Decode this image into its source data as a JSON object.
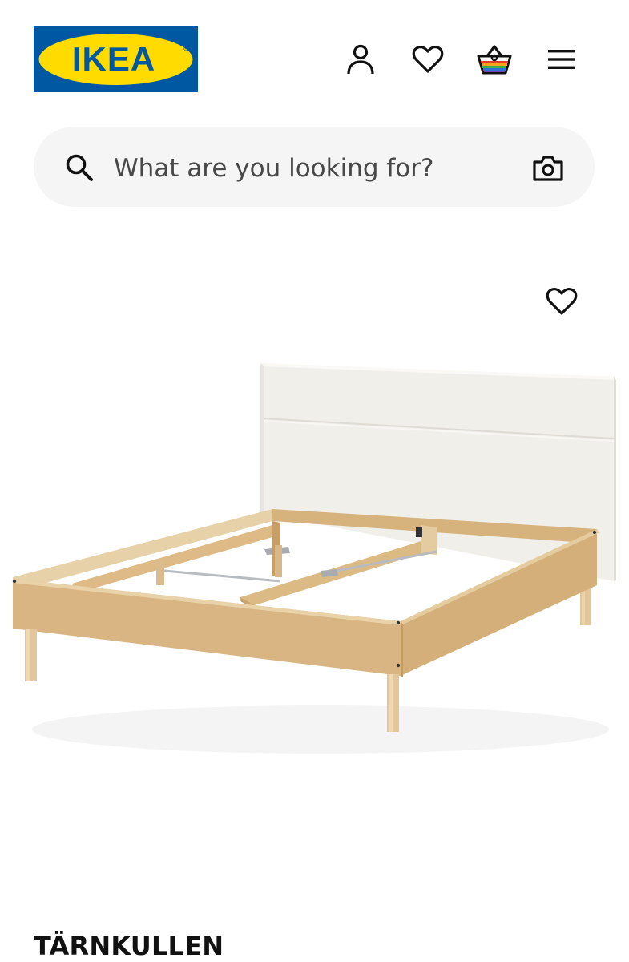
{
  "header": {
    "logo_text": "IKEA",
    "logo_registered": "®",
    "icons": {
      "account": "person-icon",
      "favorites": "heart-icon",
      "cart": "shopping-basket-icon",
      "menu": "hamburger-menu-icon"
    }
  },
  "colors": {
    "brand_blue": "#0058A3",
    "brand_yellow": "#FFDB00",
    "search_bg": "#F5F5F5",
    "text": "#111111",
    "wood": "#D9B98A"
  },
  "search": {
    "placeholder": "What are you looking for?",
    "value": "",
    "icons": {
      "search": "magnifier-icon",
      "visual_search": "camera-icon"
    }
  },
  "product": {
    "name": "TÄRNKULLEN",
    "image": "bed-frame-with-upholstered-headboard"
  }
}
